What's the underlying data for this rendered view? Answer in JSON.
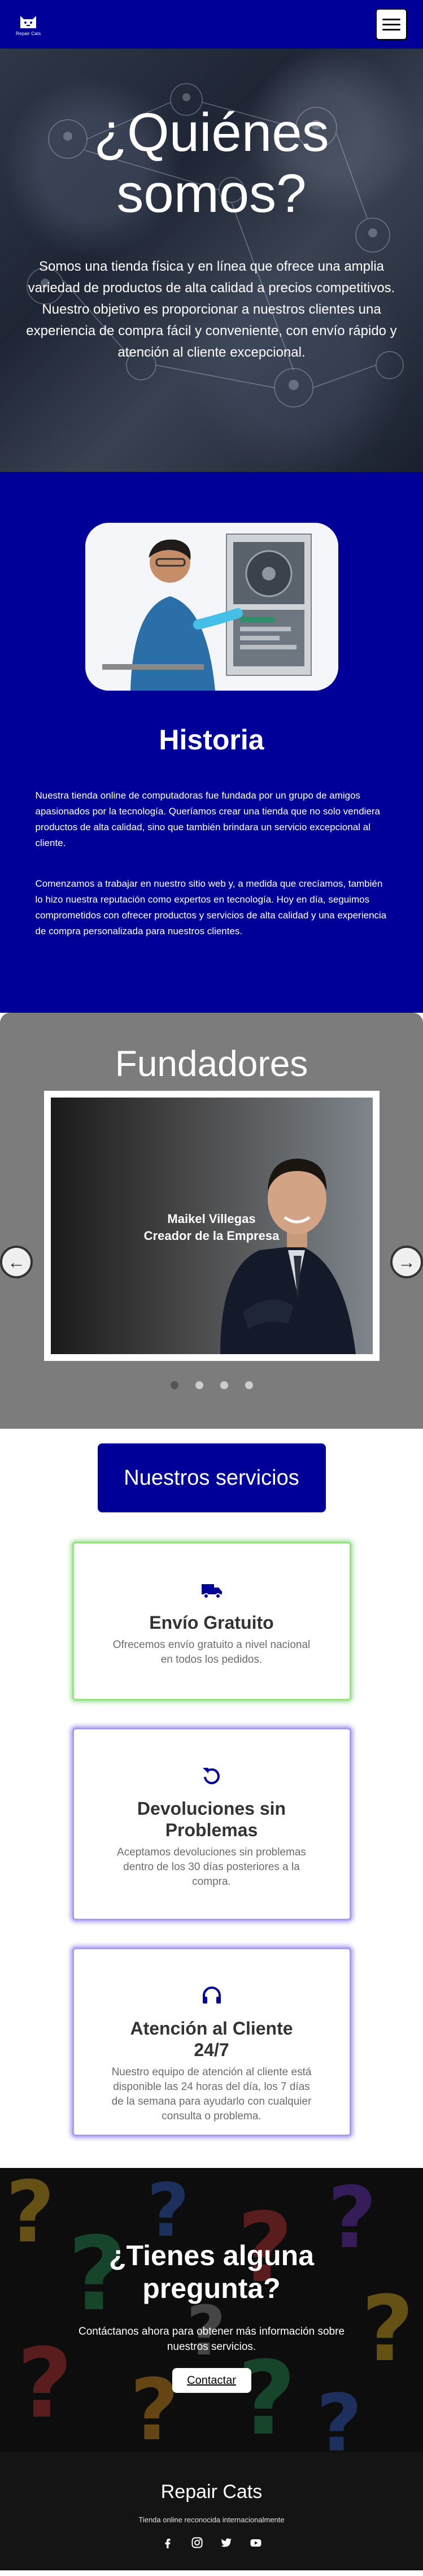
{
  "navbar": {
    "brand_name": "Repair Cats"
  },
  "hero": {
    "title": "¿Quiénes somos?",
    "text_1": "Somos una tienda física y en línea que ofrece una amplia variedad de productos de alta calidad a precios competitivos.",
    "text_2": "Nuestro objetivo es proporcionar a nuestros clientes una experiencia de compra fácil y conveniente, con envío rápido y atención al cliente excepcional."
  },
  "historia": {
    "title": "Historia",
    "p1": "Nuestra tienda online de computadoras fue fundada por un grupo de amigos apasionados por la tecnología. Queríamos crear una tienda que no solo vendiera productos de alta calidad, sino que también brindara un servicio excepcional al cliente.",
    "p2": "Comenzamos a trabajar en nuestro sitio web y, a medida que crecíamos, también lo hizo nuestra reputación como expertos en tecnología. Hoy en día, seguimos comprometidos con ofrecer productos y servicios de alta calidad y una experiencia de compra personalizada para nuestros clientes."
  },
  "fundadores": {
    "title": "Fundadores",
    "slide_name": "Maikel Villegas",
    "slide_role": "Creador de la Empresa",
    "slide_count": 4,
    "active_slide": 1
  },
  "servicios": {
    "title": "Nuestros servicios",
    "cards": [
      {
        "icon": "truck-icon",
        "title": "Envío Gratuito",
        "desc": "Ofrecemos envío gratuito a nivel nacional en todos los pedidos."
      },
      {
        "icon": "undo-icon",
        "title": "Devoluciones sin Problemas",
        "desc": "Aceptamos devoluciones sin problemas dentro de los 30 días posteriores a la compra."
      },
      {
        "icon": "headset-icon",
        "title": "Atención al Cliente 24/7",
        "desc": "Nuestro equipo de atención al cliente está disponible las 24 horas del día, los 7 días de la semana para ayudarlo con cualquier consulta o problema."
      }
    ]
  },
  "contact": {
    "title": "¿Tienes alguna pregunta?",
    "text": "Contáctanos ahora para obtener más información sobre nuestros servicios.",
    "button": "Contactar"
  },
  "footer": {
    "title": "Repair Cats",
    "text": "Tienda online reconocida internacionalmente"
  },
  "colors": {
    "primary": "#000099",
    "grey_section": "#7c7c7c",
    "footer": "#141414"
  }
}
